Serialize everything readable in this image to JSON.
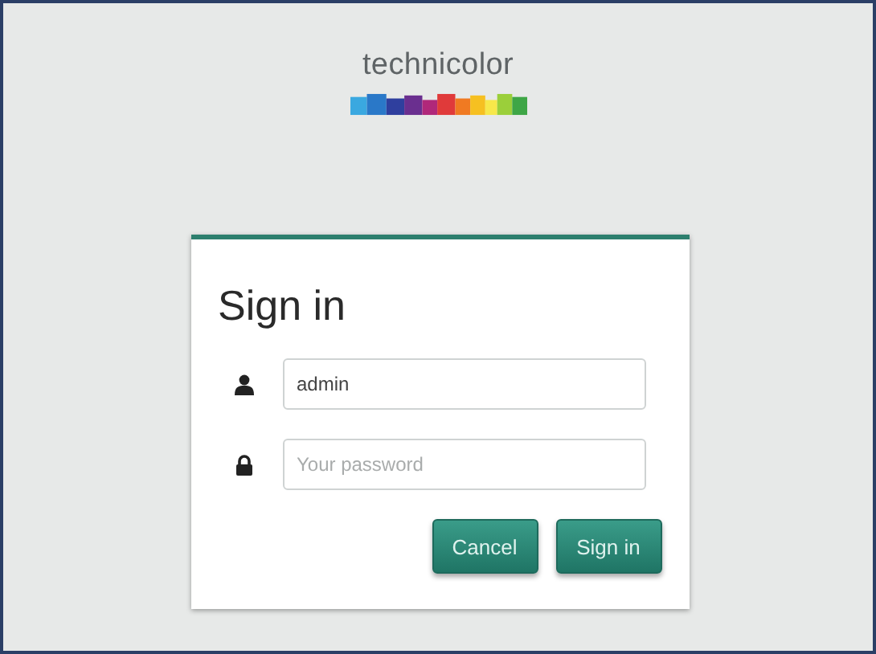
{
  "logo": {
    "text": "technicolor"
  },
  "login": {
    "title": "Sign in",
    "fields": [
      {
        "kind": "user",
        "value": "admin"
      },
      {
        "kind": "password",
        "placeholder": "Your password"
      }
    ],
    "buttons": [
      "Cancel",
      "Sign in"
    ]
  }
}
